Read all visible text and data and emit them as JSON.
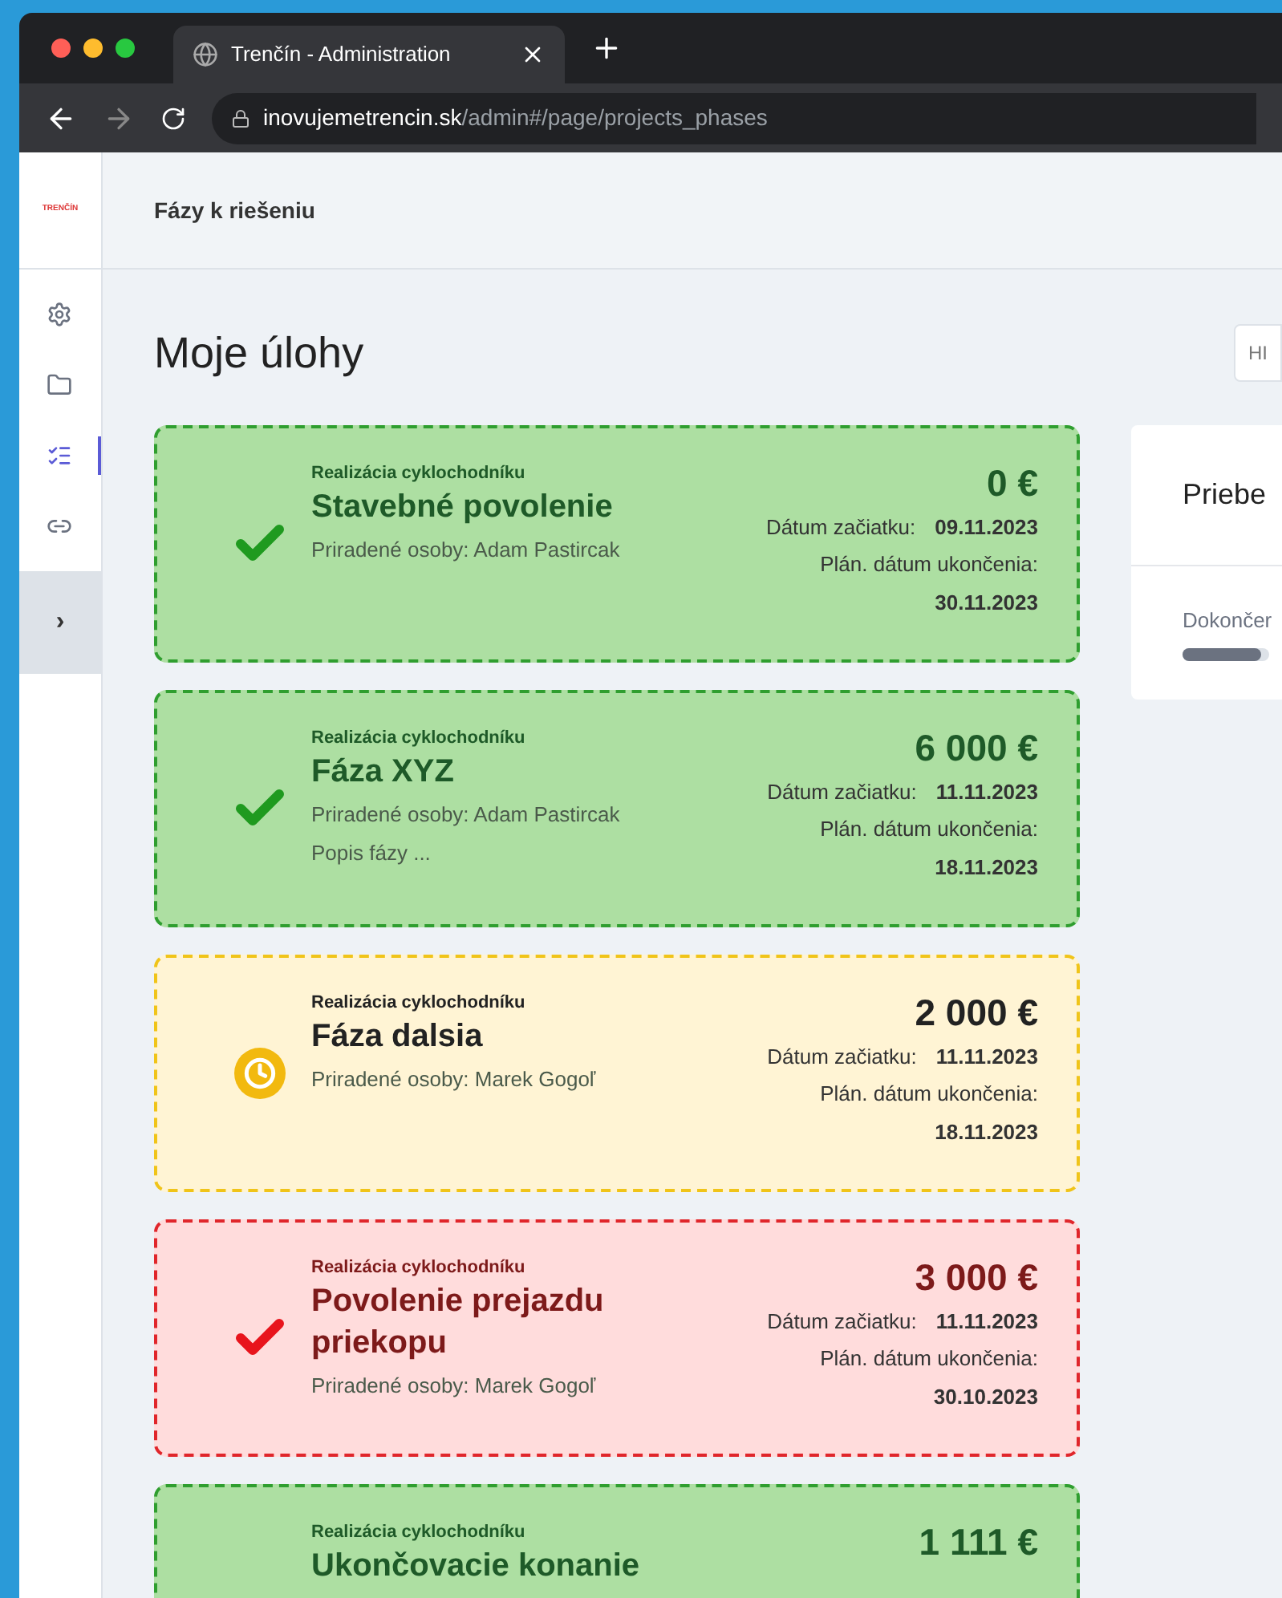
{
  "browser": {
    "tab_title": "Trenčín - Administration",
    "url_host": "inovujemetrencin.sk",
    "url_path": "/admin#/page/projects_phases"
  },
  "header": {
    "logo_text": "TRENČÍN",
    "title": "Fázy k riešeniu"
  },
  "sidebar": {
    "items": [
      {
        "selected": false
      },
      {
        "selected": false
      },
      {
        "selected": true
      },
      {
        "selected": false
      }
    ],
    "expand_label": "›"
  },
  "page": {
    "title": "Moje úlohy",
    "button_label": "HI"
  },
  "tasks": [
    {
      "kind": "done",
      "project": "Realizácia cyklochodníku",
      "title": "Stavebné povolenie",
      "persons": "Priradené osoby: Adam Pastircak",
      "amount": "0 €",
      "start_label": "Dátum začiatku:",
      "start": "09.11.2023",
      "end_label": "Plán. dátum ukončenia:",
      "end": "30.11.2023"
    },
    {
      "kind": "done",
      "project": "Realizácia cyklochodníku",
      "title": "Fáza XYZ",
      "persons": "Priradené osoby: Adam Pastircak",
      "description": "Popis fázy ...",
      "amount": "6 000 €",
      "start_label": "Dátum začiatku:",
      "start": "11.11.2023",
      "end_label": "Plán. dátum ukončenia:",
      "end": "18.11.2023"
    },
    {
      "kind": "pending",
      "project": "Realizácia cyklochodníku",
      "title": "Fáza dalsia",
      "persons": "Priradené osoby: Marek Gogoľ",
      "amount": "2 000 €",
      "start_label": "Dátum začiatku:",
      "start": "11.11.2023",
      "end_label": "Plán. dátum ukončenia:",
      "end": "18.11.2023"
    },
    {
      "kind": "overdue",
      "project": "Realizácia cyklochodníku",
      "title": "Povolenie prejazdu priekopu",
      "persons": "Priradené osoby: Marek Gogoľ",
      "amount": "3 000 €",
      "start_label": "Dátum začiatku:",
      "start": "11.11.2023",
      "end_label": "Plán. dátum ukončenia:",
      "end": "30.10.2023"
    },
    {
      "kind": "done",
      "project": "Realizácia cyklochodníku",
      "title": "Ukončovacie konanie",
      "amount": "1 111 €"
    }
  ],
  "progress_panel": {
    "title": "Priebe",
    "label": "Dokončer",
    "level": 0.9
  }
}
